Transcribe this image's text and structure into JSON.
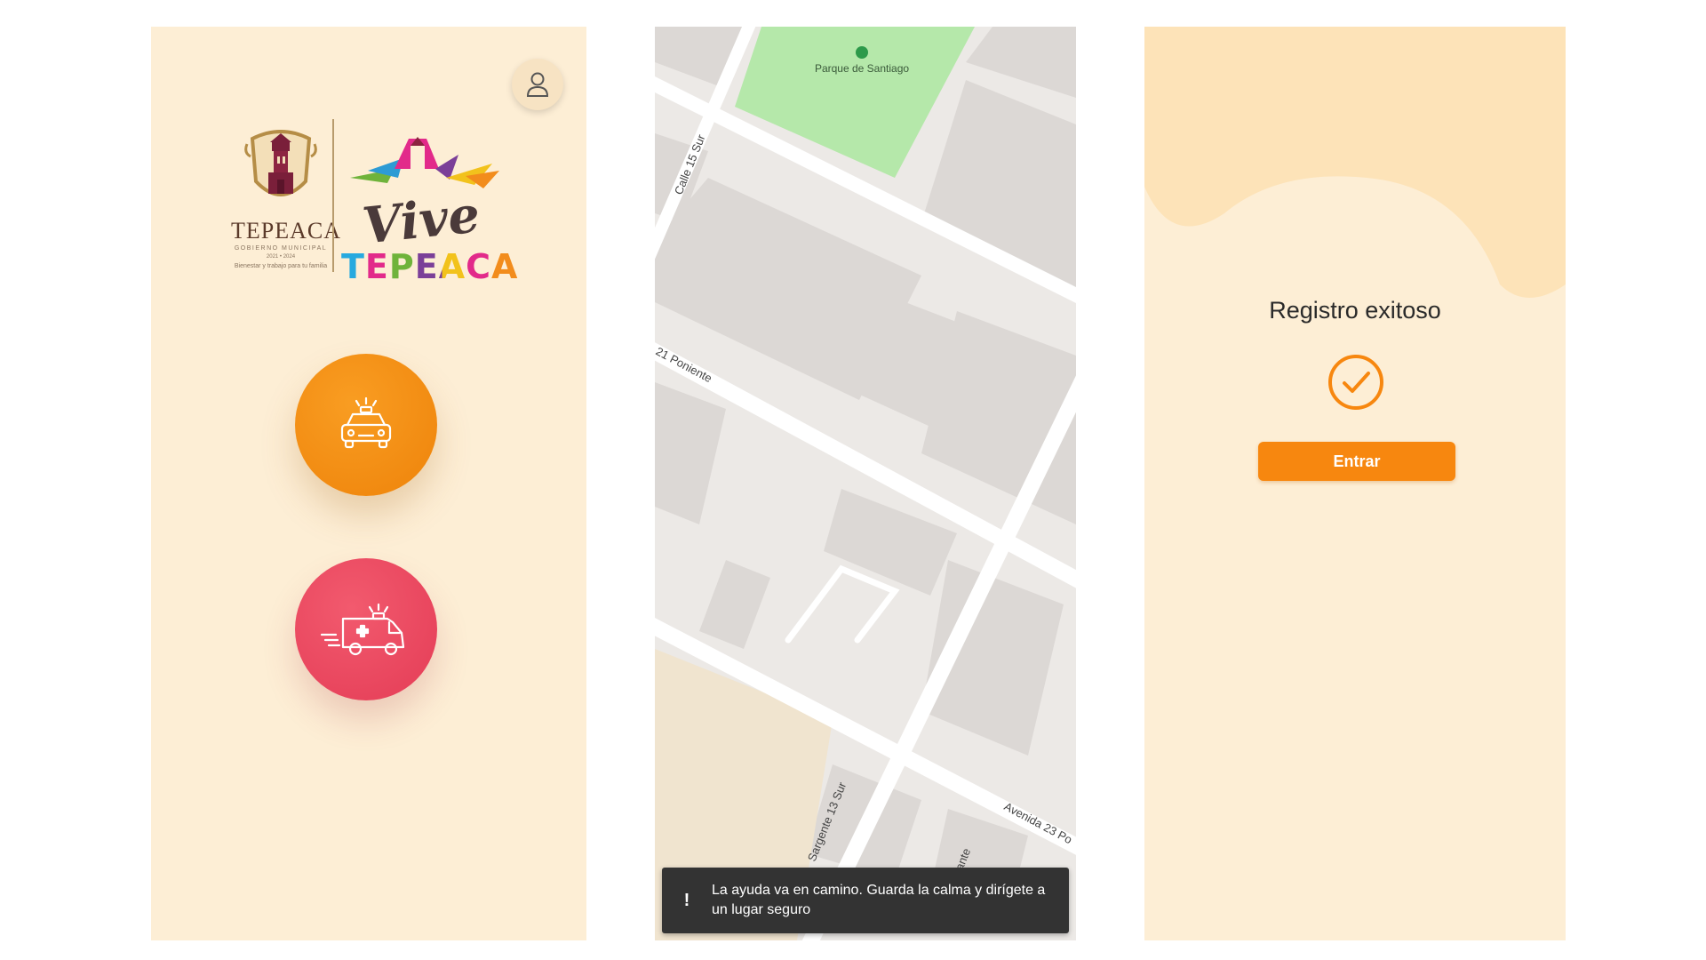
{
  "colors": {
    "background": "#fdeed5",
    "accent_orange": "#f7870f",
    "accent_red": "#e43c56",
    "toast_bg": "#333333"
  },
  "screen1": {
    "profile_icon": "user-icon",
    "logo": {
      "municipality": "TEPEACA",
      "government": "GOBIERNO MUNICIPAL",
      "years": "2021 • 2024",
      "slogan": "Bienestar y trabajo para tu familia",
      "vive": "Vive",
      "tepeaca": "TEPEACA"
    },
    "buttons": [
      {
        "name": "taxi",
        "icon": "taxi-icon"
      },
      {
        "name": "ambulance",
        "icon": "ambulance-icon"
      }
    ]
  },
  "screen2": {
    "map_labels": {
      "park": "Parque de Santiago",
      "street_15_sur": "Calle 15 Sur",
      "street_21_poniente": "21 Poniente",
      "street_13_sur": "Sargente 13 Sur",
      "avenue_23": "Avenida 23 Po",
      "street_partial": "ante"
    },
    "toast": {
      "icon": "!",
      "message": "La ayuda va en camino. Guarda la calma y dirígete a un lugar seguro"
    }
  },
  "screen3": {
    "title": "Registro exitoso",
    "check_icon": "check-circle-icon",
    "enter_button": "Entrar"
  }
}
